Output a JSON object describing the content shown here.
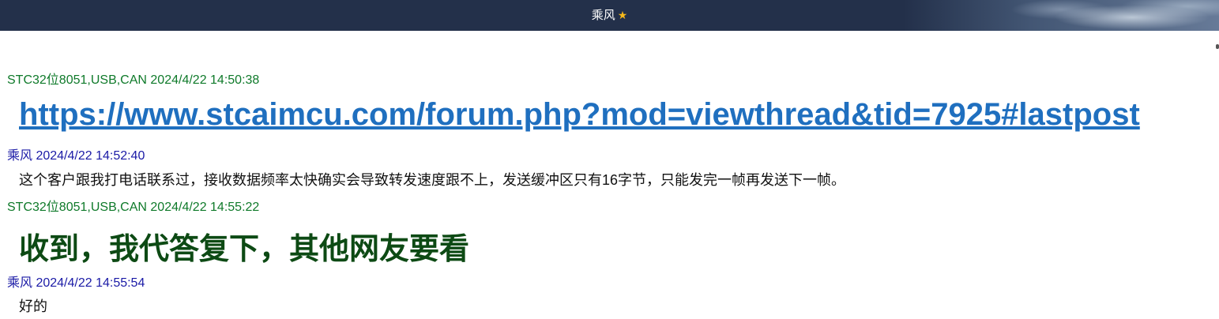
{
  "header": {
    "title": "乘风",
    "star_icon": "star-icon",
    "accent": "#23304a"
  },
  "messages": [
    {
      "sender": "STC32位8051,USB,CAN",
      "timestamp": "2024/4/22 14:50:38",
      "meta": "STC32位8051,USB,CAN 2024/4/22 14:50:38",
      "text": "https://www.stcaimcu.com/forum.php?mod=viewthread&tid=7925#lastpost",
      "style": "link",
      "color": "#1f6fbf"
    },
    {
      "sender": "乘风",
      "timestamp": "2024/4/22 14:52:40",
      "meta": "乘风 2024/4/22 14:52:40",
      "text": "这个客户跟我打电话联系过，接收数据频率太快确实会导致转发速度跟不上，发送缓冲区只有16字节，只能发完一帧再发送下一帧。",
      "style": "normal",
      "color": "#111111"
    },
    {
      "sender": "STC32位8051,USB,CAN",
      "timestamp": "2024/4/22 14:55:22",
      "meta": "STC32位8051,USB,CAN 2024/4/22 14:55:22",
      "text": "收到，我代答复下，其他网友要看",
      "style": "bold-green",
      "color": "#0d4a14"
    },
    {
      "sender": "乘风",
      "timestamp": "2024/4/22 14:55:54",
      "meta": "乘风 2024/4/22 14:55:54",
      "text": "好的",
      "style": "normal",
      "color": "#111111"
    }
  ]
}
